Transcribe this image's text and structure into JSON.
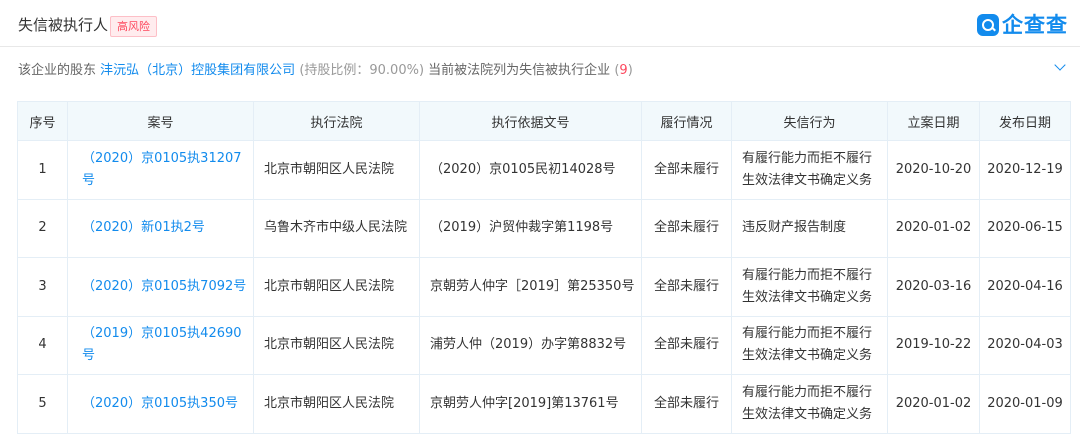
{
  "header": {
    "title": "失信被执行人",
    "risk_badge": "高风险",
    "logo_text": "企查查"
  },
  "summary": {
    "prefix": "该企业的股东",
    "shareholder": "沣沅弘（北京）控股集团有限公司",
    "ratio": "(持股比例：90.00%)",
    "middle": "当前被法院列为失信被执行企业",
    "count_open": "(",
    "count": "9",
    "count_close": ")"
  },
  "table": {
    "headers": [
      "序号",
      "案号",
      "执行法院",
      "执行依据文号",
      "履行情况",
      "失信行为",
      "立案日期",
      "发布日期"
    ],
    "rows": [
      [
        "1",
        "（2020）京0105执31207号",
        "北京市朝阳区人民法院",
        "（2020）京0105民初14028号",
        "全部未履行",
        "有履行能力而拒不履行生效法律文书确定义务",
        "2020-10-20",
        "2020-12-19"
      ],
      [
        "2",
        "（2020）新01执2号",
        "乌鲁木齐市中级人民法院",
        "（2019）沪贸仲裁字第1198号",
        "全部未履行",
        "违反财产报告制度",
        "2020-01-02",
        "2020-06-15"
      ],
      [
        "3",
        "（2020）京0105执7092号",
        "北京市朝阳区人民法院",
        "京朝劳人仲字［2019］第25350号",
        "全部未履行",
        "有履行能力而拒不履行生效法律文书确定义务",
        "2020-03-16",
        "2020-04-16"
      ],
      [
        "4",
        "（2019）京0105执42690号",
        "北京市朝阳区人民法院",
        "浦劳人仲（2019）办字第8832号",
        "全部未履行",
        "有履行能力而拒不履行生效法律文书确定义务",
        "2019-10-22",
        "2020-04-03"
      ],
      [
        "5",
        "（2020）京0105执350号",
        "北京市朝阳区人民法院",
        "京朝劳人仲字[2019]第13761号",
        "全部未履行",
        "有履行能力而拒不履行生效法律文书确定义务",
        "2020-01-02",
        "2020-01-09"
      ]
    ]
  },
  "colors": {
    "accent": "#128bed",
    "danger": "#fd485e",
    "header_bg": "#f2f9fc"
  }
}
